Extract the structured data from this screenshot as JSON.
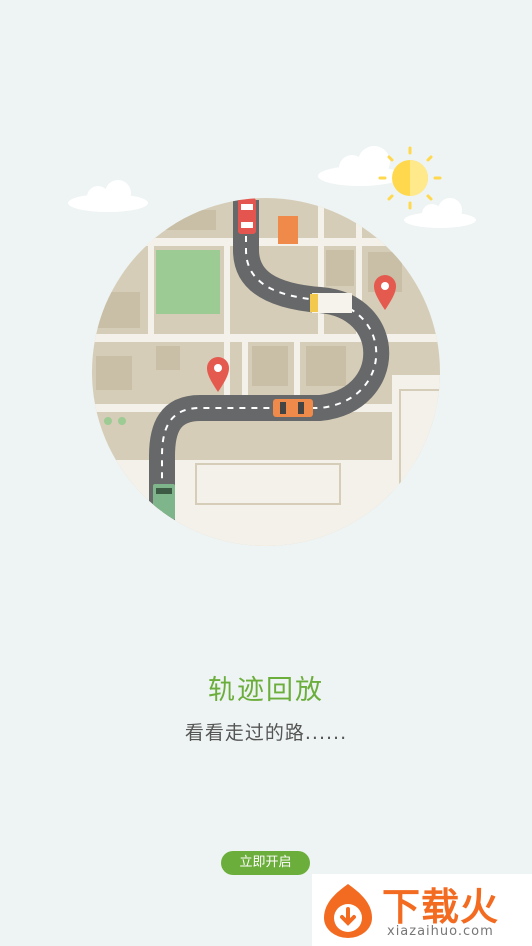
{
  "feature": {
    "title": "轨迹回放",
    "subtitle": "看看走过的路......"
  },
  "start_button": {
    "label": "立即开启"
  },
  "watermark": {
    "title": "下载火",
    "url": "xiazaihuo.com"
  },
  "colors": {
    "background": "#eef4f3",
    "accent": "#6cae3c",
    "map_ground": "#d6cdb8",
    "road": "#66686a",
    "pin": "#e55a4e",
    "watermark": "#f36b21"
  },
  "icons": [
    "sun-icon",
    "cloud-icon",
    "location-pin-icon",
    "car-icon",
    "truck-icon",
    "bus-icon",
    "download-logo-icon"
  ]
}
